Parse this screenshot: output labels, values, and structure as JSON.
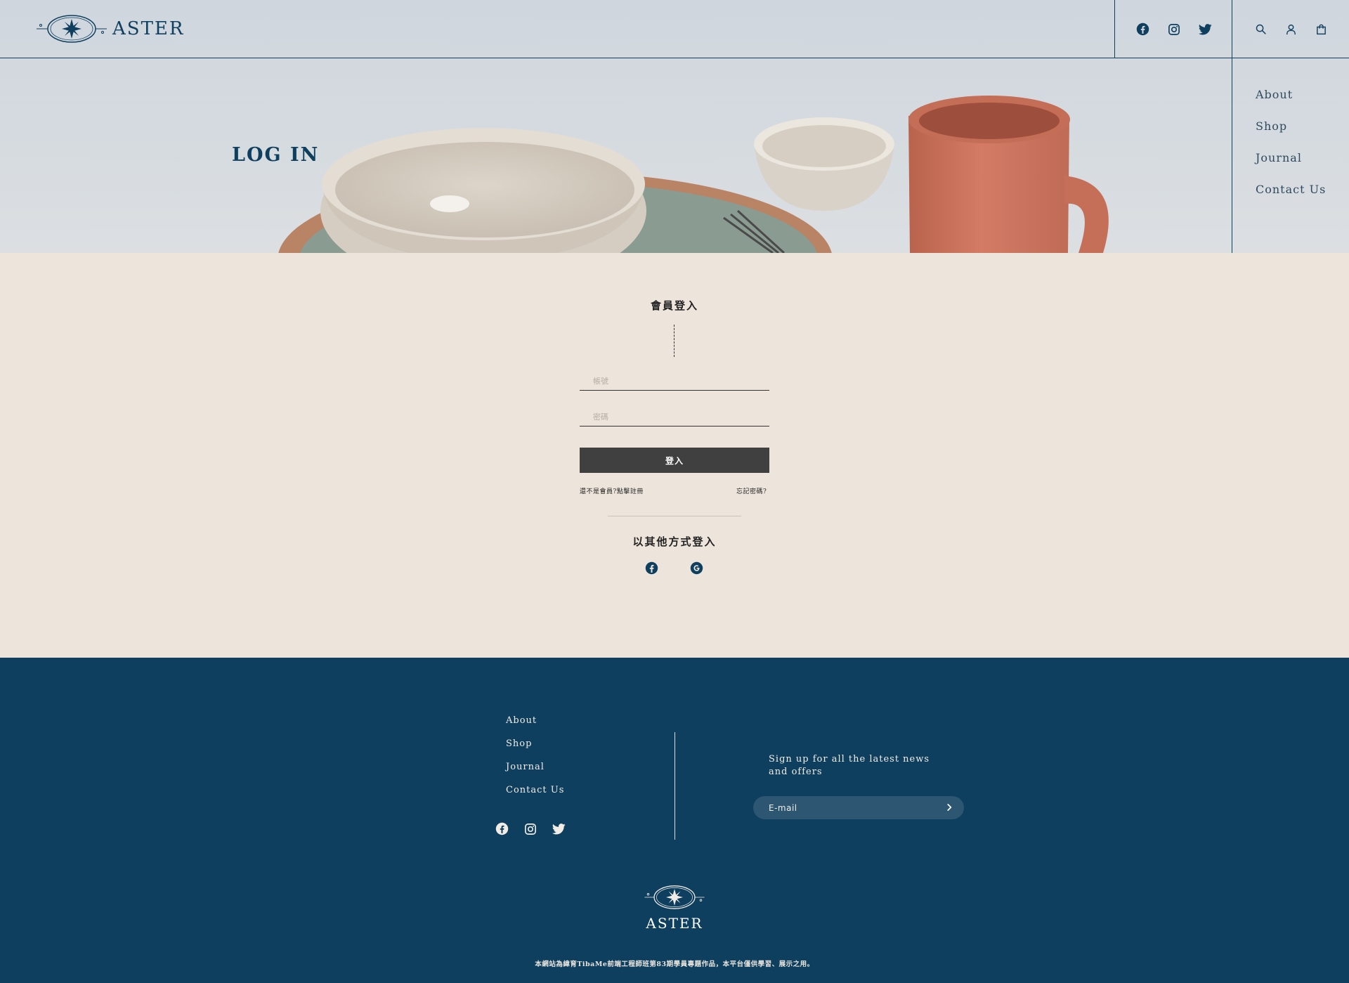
{
  "brand": {
    "name": "ASTER"
  },
  "header": {
    "social": [
      "facebook-icon",
      "instagram-icon",
      "twitter-icon"
    ],
    "tools": [
      "search-icon",
      "user-icon",
      "cart-icon"
    ]
  },
  "side_nav": {
    "items": [
      {
        "label": "About"
      },
      {
        "label": "Shop"
      },
      {
        "label": "Journal"
      },
      {
        "label": "Contact Us"
      }
    ]
  },
  "hero": {
    "title": "LOG IN"
  },
  "login": {
    "title": "會員登入",
    "account_placeholder": "帳號",
    "password_placeholder": "密碼",
    "submit_label": "登入",
    "register_link": "還不是會員?點擊註冊",
    "forgot_link": "忘記密碼?",
    "other_title": "以其他方式登入",
    "oauth": [
      "facebook-icon",
      "google-icon"
    ]
  },
  "footer": {
    "nav": [
      {
        "label": "About"
      },
      {
        "label": "Shop"
      },
      {
        "label": "Journal"
      },
      {
        "label": "Contact Us"
      }
    ],
    "signup_text": "Sign up for all the latest news and offers",
    "email_placeholder": "E-mail",
    "brand": "ASTER",
    "copyright": "本網站為緯育TibaMe前端工程師班第83期學員專題作品，本平台僅供學習、展示之用。"
  },
  "colors": {
    "navy": "#0f3f5f",
    "cream": "#ede5db",
    "button": "#404040"
  }
}
